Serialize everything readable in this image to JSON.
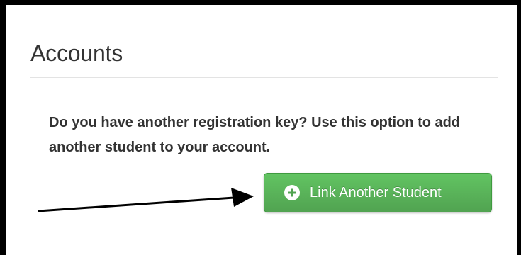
{
  "panel": {
    "title": "Accounts",
    "description": "Do you have another registration key? Use this option to add another student to your account.",
    "button_label": "Link Another Student"
  },
  "icons": {
    "button_icon": "plus-circle-icon",
    "annotation": "arrow-right-icon"
  },
  "colors": {
    "button_top": "#62c462",
    "button_bottom": "#51a351",
    "button_text": "#ffffff",
    "heading_text": "#333333",
    "frame_border": "#000000"
  }
}
